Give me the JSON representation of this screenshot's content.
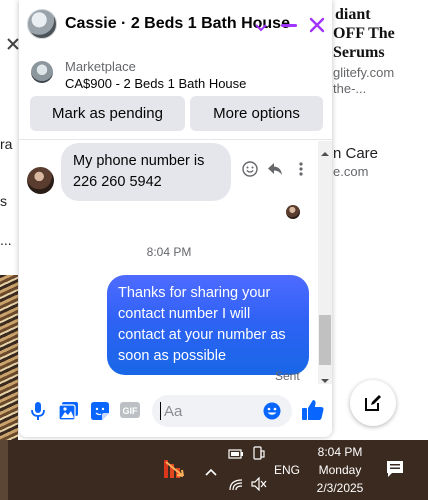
{
  "background": {
    "right_lines": [
      "diant",
      "OFF The",
      "Serums",
      "glitefy.com",
      "the-...",
      "n Care",
      "e.com"
    ],
    "left_lines": [
      "ra",
      "s",
      "..."
    ]
  },
  "chat": {
    "contact_title": "Cassie · 2 Beds 1 Bath House",
    "listing": {
      "label": "Marketplace",
      "price_title": "CA$900 - 2 Beds 1 Bath House"
    },
    "buttons": {
      "mark_pending": "Mark as pending",
      "more_options": "More options"
    },
    "messages": [
      {
        "direction": "incoming",
        "text": "My phone number is 226 260 5942"
      },
      {
        "direction": "outgoing",
        "text": "Thanks for sharing your contact number I will contact at your number as soon as possible"
      }
    ],
    "timestamp": "8:04 PM",
    "status": "Sent",
    "composer": {
      "placeholder": "Aa",
      "value": ""
    },
    "colors": {
      "accent": "#a033ff",
      "outgoing_bubble_top": "#4f6bff",
      "outgoing_bubble_bottom": "#1867e6",
      "icon_blue": "#0866ff"
    }
  },
  "taskbar": {
    "language": "ENG",
    "time": "8:04 PM",
    "day": "Monday",
    "date": "2/3/2025"
  }
}
